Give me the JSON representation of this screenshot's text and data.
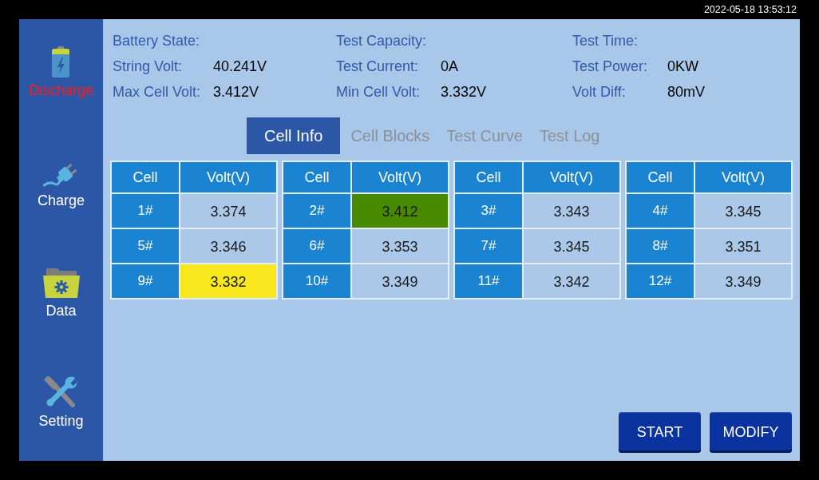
{
  "status_bar": {
    "datetime": "2022-05-18 13:53:12"
  },
  "sidebar": {
    "items": [
      {
        "label": "Discharge",
        "selected": true
      },
      {
        "label": "Charge",
        "selected": false
      },
      {
        "label": "Data",
        "selected": false
      },
      {
        "label": "Setting",
        "selected": false
      }
    ]
  },
  "info": {
    "rows": [
      [
        {
          "label": "Battery State:"
        },
        {
          "label": "Test Capacity:"
        },
        {
          "label": "Test Time:"
        }
      ],
      [
        {
          "label": "String Volt:",
          "value": "40.241V"
        },
        {
          "label": "Test Current:",
          "value": "0A"
        },
        {
          "label": "Test Power:",
          "value": "0KW"
        }
      ],
      [
        {
          "label": "Max Cell Volt:",
          "value": "3.412V"
        },
        {
          "label": "Min Cell Volt:",
          "value": "3.332V"
        },
        {
          "label": "Volt Diff:",
          "value": "80mV"
        }
      ]
    ]
  },
  "tabs": [
    {
      "label": "Cell Info",
      "selected": true
    },
    {
      "label": "Cell Blocks",
      "selected": false
    },
    {
      "label": "Test Curve",
      "selected": false
    },
    {
      "label": "Test Log",
      "selected": false
    }
  ],
  "tables": [
    {
      "columns": [
        "Cell",
        "Volt(V)"
      ],
      "rows": [
        {
          "cell": "1#",
          "volt": "3.374"
        },
        {
          "cell": "5#",
          "volt": "3.346"
        },
        {
          "cell": "9#",
          "volt": "3.332",
          "color": "#f8e71c"
        }
      ]
    },
    {
      "columns": [
        "Cell",
        "Volt(V)"
      ],
      "rows": [
        {
          "cell": "2#",
          "volt": "3.412",
          "color": "#478a00"
        },
        {
          "cell": "6#",
          "volt": "3.353"
        },
        {
          "cell": "10#",
          "volt": "3.349"
        }
      ]
    },
    {
      "columns": [
        "Cell",
        "Volt(V)"
      ],
      "rows": [
        {
          "cell": "3#",
          "volt": "3.343"
        },
        {
          "cell": "7#",
          "volt": "3.345"
        },
        {
          "cell": "11#",
          "volt": "3.342"
        }
      ]
    },
    {
      "columns": [
        "Cell",
        "Volt(V)"
      ],
      "rows": [
        {
          "cell": "4#",
          "volt": "3.345"
        },
        {
          "cell": "8#",
          "volt": "3.351"
        },
        {
          "cell": "12#",
          "volt": "3.349"
        }
      ]
    }
  ],
  "buttons": [
    "START",
    "MODIFY"
  ]
}
